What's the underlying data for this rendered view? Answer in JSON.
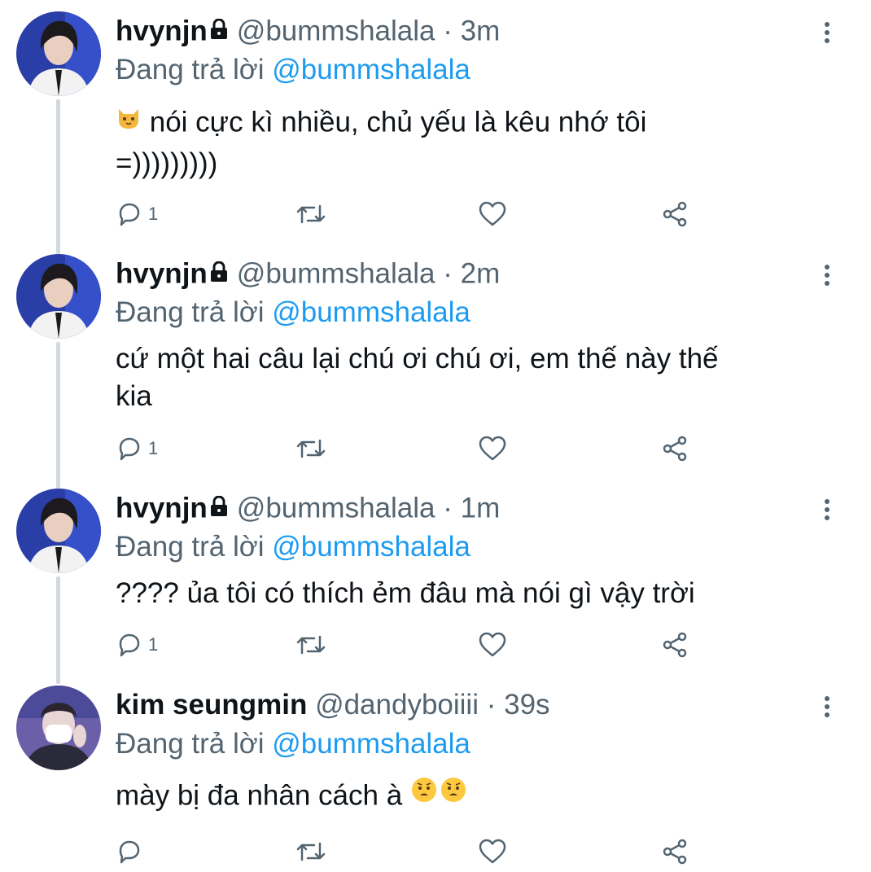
{
  "colors": {
    "accent": "#1d9bf0",
    "secondary": "#536471",
    "text": "#0f1419",
    "thread_line": "#cfd9de"
  },
  "tweets": [
    {
      "name": "hvynjn",
      "locked": true,
      "handle": "@bummshalala",
      "separator": "·",
      "time": "3m",
      "reply_prefix": "Đang trả lời",
      "reply_mention": "@bummshalala",
      "emoji": "cat-face-emoji",
      "text_line1": "nói cực kì nhiều, chủ yếu là kêu nhớ tôi",
      "text_line2": "=)))))))))",
      "reply_count": "1"
    },
    {
      "name": "hvynjn",
      "locked": true,
      "handle": "@bummshalala",
      "separator": "·",
      "time": "2m",
      "reply_prefix": "Đang trả lời",
      "reply_mention": "@bummshalala",
      "text_line1": "cứ một hai câu lại chú ơi chú ơi, em thế này thế",
      "text_line2": "kia",
      "reply_count": "1"
    },
    {
      "name": "hvynjn",
      "locked": true,
      "handle": "@bummshalala",
      "separator": "·",
      "time": "1m",
      "reply_prefix": "Đang trả lời",
      "reply_mention": "@bummshalala",
      "text_line1": "???? ủa tôi có thích ẻm đâu mà nói gì vậy trời",
      "reply_count": "1"
    },
    {
      "name": "kim seungmin",
      "locked": false,
      "handle": "@dandyboiiii",
      "separator": "·",
      "time": "39s",
      "reply_prefix": "Đang trả lời",
      "reply_mention": "@bummshalala",
      "text_line1": "mày bị đa nhân cách à",
      "emoji_trailing": "worried-face-emoji",
      "reply_count": ""
    }
  ],
  "icons": [
    "lock-icon",
    "more-icon",
    "reply-icon",
    "retweet-icon",
    "like-icon",
    "share-icon"
  ]
}
